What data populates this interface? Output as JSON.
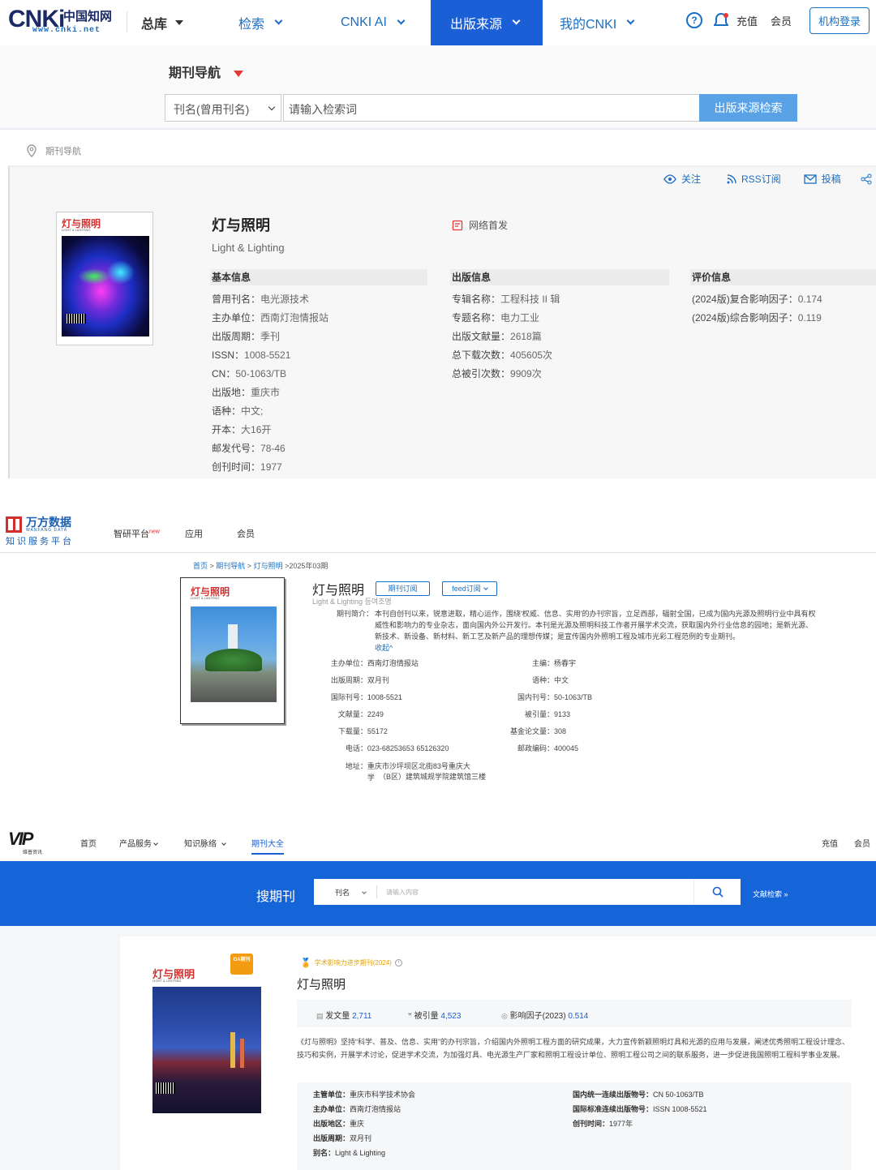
{
  "cnki": {
    "logo": {
      "mark": "CNKi",
      "cn": "中国知网",
      "url": "www.cnki.net"
    },
    "nav": [
      {
        "label": "总库"
      },
      {
        "label": "检索"
      },
      {
        "label": "CNKI AI"
      },
      {
        "label": "出版来源"
      },
      {
        "label": "我的CNKI"
      }
    ],
    "right": {
      "recharge": "充值",
      "member": "会员",
      "login": "机构登录"
    },
    "journal_nav": "期刊导航",
    "search": {
      "select": "刊名(曾用刊名)",
      "placeholder": "请输入检索词",
      "button": "出版来源检索"
    },
    "breadcrumb": "期刊导航",
    "actions": {
      "follow": "关注",
      "rss": "RSS订阅",
      "submit": "投稿"
    },
    "title": "灯与照明",
    "subtitle": "Light & Lighting",
    "network_first": "网络首发",
    "cover": {
      "title": "灯与照明",
      "sub": "LIGHT & LIGHTING"
    },
    "basic": {
      "heading": "基本信息",
      "rows": [
        {
          "k": "曾用刊名：",
          "v": "电光源技术"
        },
        {
          "k": "主办单位：",
          "v": "西南灯泡情报站"
        },
        {
          "k": "出版周期：",
          "v": "季刊"
        },
        {
          "k": "ISSN：",
          "v": "1008-5521"
        },
        {
          "k": "CN：",
          "v": "50-1063/TB"
        },
        {
          "k": "出版地：",
          "v": "重庆市"
        },
        {
          "k": "语种：",
          "v": "中文;"
        },
        {
          "k": "开本：",
          "v": "大16开"
        },
        {
          "k": "邮发代号：",
          "v": "78-46"
        },
        {
          "k": "创刊时间：",
          "v": "1977"
        }
      ]
    },
    "pub": {
      "heading": "出版信息",
      "rows": [
        {
          "k": "专辑名称：",
          "v": "工程科技 II 辑"
        },
        {
          "k": "专题名称：",
          "v": "电力工业"
        },
        {
          "k": "出版文献量：",
          "v": "2618篇"
        },
        {
          "k": "总下载次数：",
          "v": "405605次"
        },
        {
          "k": "总被引次数：",
          "v": "9909次"
        }
      ]
    },
    "eval": {
      "heading": "评价信息",
      "rows": [
        {
          "k": "(2024版)复合影响因子：",
          "v": "0.174"
        },
        {
          "k": "(2024版)综合影响因子：",
          "v": "0.119"
        }
      ]
    }
  },
  "wanfang": {
    "logo": {
      "cn": "万方数据",
      "en": "WANFANG DATA",
      "sub": "知识服务平台"
    },
    "nav": [
      {
        "label": "智研平台",
        "badge": "new"
      },
      {
        "label": "应用"
      },
      {
        "label": "会员"
      }
    ],
    "breadcrumb": {
      "home": "首页",
      "nav": "期刊导航",
      "journal": "灯与照明",
      "issue": ">2025年03期"
    },
    "title": "灯与照明",
    "btn_subscribe": "期刊订阅",
    "btn_feed": "feed订阅",
    "subtitle": "Light & Lighting",
    "subtitle_extra": "등여조명",
    "intro_label": "期刊简介：",
    "intro": "本刊自创刊以来，锐意进取，精心运作，围绕'权威、信息、实用'的办刊宗旨，立足西部，辐射全国，已成为国内光源及照明行业中具有权威性和影响力的专业杂志，面向国内外公开发行。本刊是光源及照明科技工作者开展学术交流，获取国内外行业信息的园地；是新光源、新技术、新设备、新材料、新工艺及新产品的理想传媒；是宣传国内外照明工程及城市光彩工程范例的专业期刊。",
    "collapse": "收起^",
    "cover": {
      "title": "灯与照明",
      "sub": "LIGHT & LIGHTING"
    },
    "left_rows": [
      {
        "k": "主办单位：",
        "v": "西南灯泡情报站"
      },
      {
        "k": "出版周期：",
        "v": "双月刊"
      },
      {
        "k": "国际刊号：",
        "v": "1008-5521"
      },
      {
        "k": "文献量：",
        "v": "2249"
      },
      {
        "k": "下载量：",
        "v": "55172"
      },
      {
        "k": "电话：",
        "v": "023-68253653 65126320"
      },
      {
        "k": "地址：",
        "v": "重庆市沙坪坝区北街83号重庆大学"
      }
    ],
    "address_cont": "（B区）建筑城规学院建筑馆三楼",
    "right_rows": [
      {
        "k": "主编：",
        "v": "杨春宇"
      },
      {
        "k": "语种：",
        "v": "中文"
      },
      {
        "k": "国内刊号：",
        "v": "50-1063/TB"
      },
      {
        "k": "被引量：",
        "v": "9133"
      },
      {
        "k": "基金论文量：",
        "v": "308"
      },
      {
        "k": "邮政编码：",
        "v": "400045"
      }
    ]
  },
  "vip": {
    "logo": {
      "mark": "VIP",
      "sub": "维普资讯"
    },
    "nav": [
      {
        "label": "首页"
      },
      {
        "label": "产品服务"
      },
      {
        "label": "知识脉络"
      },
      {
        "label": "期刊大全"
      }
    ],
    "right": {
      "recharge": "充值",
      "member": "会员"
    },
    "search_title": "搜期刊",
    "select": "刊名",
    "placeholder": "请输入内容",
    "adv": "文献检索 »",
    "badge": "学术影响力进步期刊(2024)",
    "title": "灯与照明",
    "cover": {
      "title": "灯与照明",
      "sub": "LIGHT & LIGHTING",
      "oa": "OA期刊"
    },
    "stats": [
      {
        "k": "发文量",
        "v": "2,711"
      },
      {
        "k": "被引量",
        "v": "4,523"
      },
      {
        "k": "影响因子(2023)",
        "v": "0.514"
      }
    ],
    "desc": "《灯与照明》坚持“科学、普及、信息、实用”的办刊宗旨，介绍国内外照明工程方面的研究成果，大力宣传新颖照明灯具和光源的应用与发展，阐述优秀照明工程设计理念、技巧和实例，开展学术讨论，促进学术交流，为加强灯具、电光源生产厂家和照明工程设计单位、照明工程公司之间的联系服务，进一步促进我国照明工程科学事业发展。",
    "left_rows": [
      {
        "k": "主管单位：",
        "v": "重庆市科学技术协会"
      },
      {
        "k": "主办单位：",
        "v": "西南灯泡情报站"
      },
      {
        "k": "出版地区：",
        "v": "重庆"
      },
      {
        "k": "出版周期：",
        "v": "双月刊"
      },
      {
        "k": "别名：",
        "v": "Light & Lighting"
      }
    ],
    "right_rows": [
      {
        "k": "国内统一连续出版物号：",
        "v": "CN 50-1063/TB"
      },
      {
        "k": "国际标准连续出版物号：",
        "v": "ISSN 1008-5521"
      },
      {
        "k": "创刊时间：",
        "v": "1977年"
      }
    ]
  }
}
